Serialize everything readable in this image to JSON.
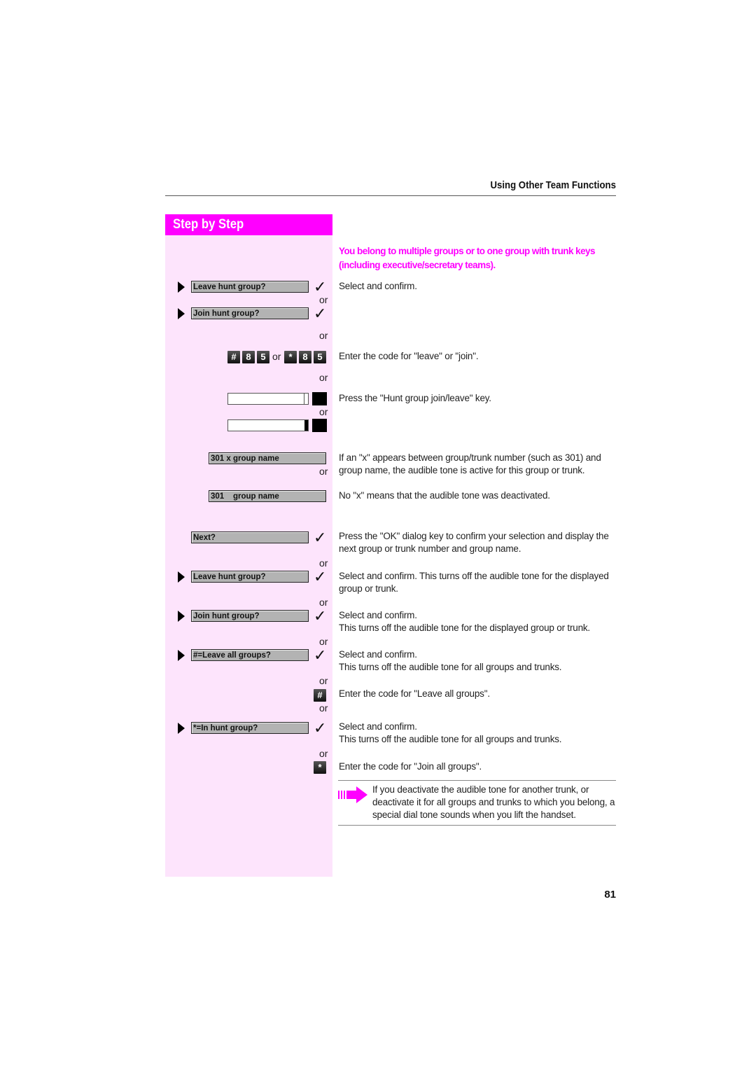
{
  "header": {
    "section_title": "Using Other Team Functions"
  },
  "sidebar": {
    "title": "Step by Step"
  },
  "intro": "You belong to multiple groups or to one group with trunk keys (including executive/secretary teams).",
  "or_label": "or",
  "steps": {
    "leave_hunt_1": "Leave hunt group?",
    "join_hunt_1": "Join hunt group?",
    "code_keys_a": [
      "#",
      "8",
      "5"
    ],
    "code_keys_b": [
      "*",
      "8",
      "5"
    ],
    "group_x": "301 x group name",
    "group_plain": "301    group name",
    "next": "Next?",
    "leave_hunt_2": "Leave hunt group?",
    "join_hunt_2": "Join hunt group?",
    "leave_all": "#=Leave all groups?",
    "hash_key": "#",
    "in_hunt": "*=In hunt group?",
    "star_key": "*"
  },
  "descriptions": {
    "select_confirm_1": "Select and confirm.",
    "enter_code": "Enter the code for \"leave\" or \"join\".",
    "press_key": "Press the \"Hunt group join/leave\" key.",
    "x_info": "If an \"x\" appears between group/trunk number (such as 301) and group name, the audible tone is active for this group or trunk.",
    "no_x": "No \"x\" means that the audible tone was deactivated.",
    "ok_key": "Press the \"OK\" dialog key to confirm your selection and display the next group or trunk number and group name.",
    "leave_desc": "Select and confirm. This turns off the audible tone for the displayed group or trunk.",
    "join_desc_1": "Select and confirm.",
    "join_desc_2": "This turns off the audible tone for the displayed group or trunk.",
    "leave_all_desc_1": "Select and confirm.",
    "leave_all_desc_2": "This turns off the audible tone for all groups and trunks.",
    "leave_all_code": "Enter the code for \"Leave all groups\".",
    "in_hunt_desc_1": "Select and confirm.",
    "in_hunt_desc_2": "This turns off the audible tone for all groups and trunks.",
    "join_all_code": "Enter the code for \"Join all groups\"."
  },
  "note": "If you deactivate the audible tone for another trunk, or deactivate it for all groups and trunks to which you belong, a special dial tone sounds when you lift the handset.",
  "page_number": "81",
  "colors": {
    "accent": "#ff00ff",
    "sidebar_bg": "#fde4fc",
    "display_bg": "#b3b3b3"
  }
}
